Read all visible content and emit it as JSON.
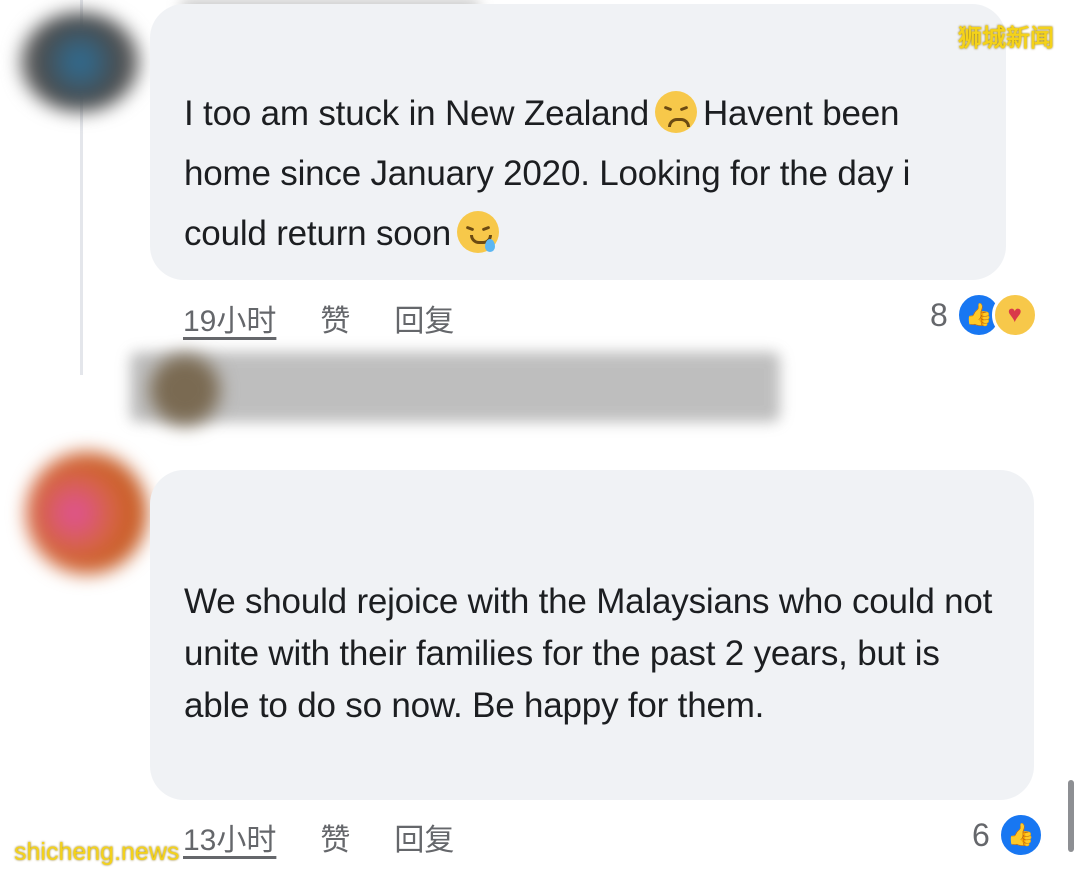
{
  "watermarks": {
    "top": "狮城新闻",
    "bottom": "shicheng.news"
  },
  "comments": [
    {
      "text_parts": [
        "I too am stuck in New Zealand",
        "Havent been home since  January 2020. Looking for the day i could return soon"
      ],
      "emojis": [
        "disappointed-face-emoji",
        "sleepy-face-emoji"
      ],
      "time": "19小时",
      "like_label": "赞",
      "reply_label": "回复",
      "reaction_count": "8",
      "reaction_icons": [
        "like-icon",
        "care-icon"
      ]
    },
    {
      "text": "We should rejoice with the Malaysians who could not unite with their families for the past 2 years, but is able to do so now. Be happy for them.",
      "time": "13小时",
      "like_label": "赞",
      "reply_label": "回复",
      "reaction_count": "6",
      "reaction_icons": [
        "like-icon"
      ]
    }
  ],
  "colors": {
    "bubble": "#f0f2f5",
    "meta_text": "#65676b",
    "like_blue": "#1877f2"
  }
}
